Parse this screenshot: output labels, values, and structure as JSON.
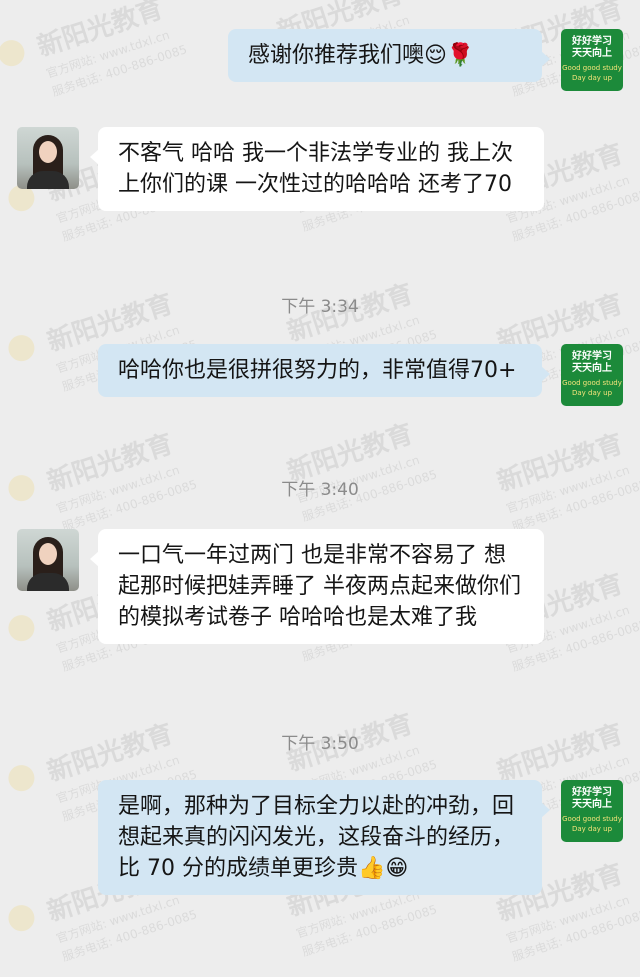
{
  "watermark": {
    "brand": "新阳光教育",
    "site": "官方网站: www.tdxl.cn",
    "phone": "服务电话: 400-886-0085"
  },
  "self_avatar": {
    "line1": "好好学习",
    "line2": "天天向上",
    "line3": "Good good study",
    "line4": "Day day up"
  },
  "messages": [
    {
      "from": "self",
      "text": "感谢你推荐我们噢😌🌹"
    },
    {
      "from": "other",
      "text": "不客气 哈哈 我一个非法学专业的 我上次上你们的课 一次性过的哈哈哈  还考了70"
    },
    {
      "type": "time",
      "text": "下午 3:34"
    },
    {
      "from": "self",
      "text": "哈哈你也是很拼很努力的，非常值得70+"
    },
    {
      "type": "time",
      "text": "下午 3:40"
    },
    {
      "from": "other",
      "text": "一口气一年过两门 也是非常不容易了 想起那时候把娃弄睡了  半夜两点起来做你们的模拟考试卷子  哈哈哈也是太难了我"
    },
    {
      "type": "time",
      "text": "下午 3:50"
    },
    {
      "from": "self",
      "text": "是啊，那种为了目标全力以赴的冲劲，回想起来真的闪闪发光，这段奋斗的经历，比 70 分的成绩单更珍贵👍😁"
    }
  ]
}
